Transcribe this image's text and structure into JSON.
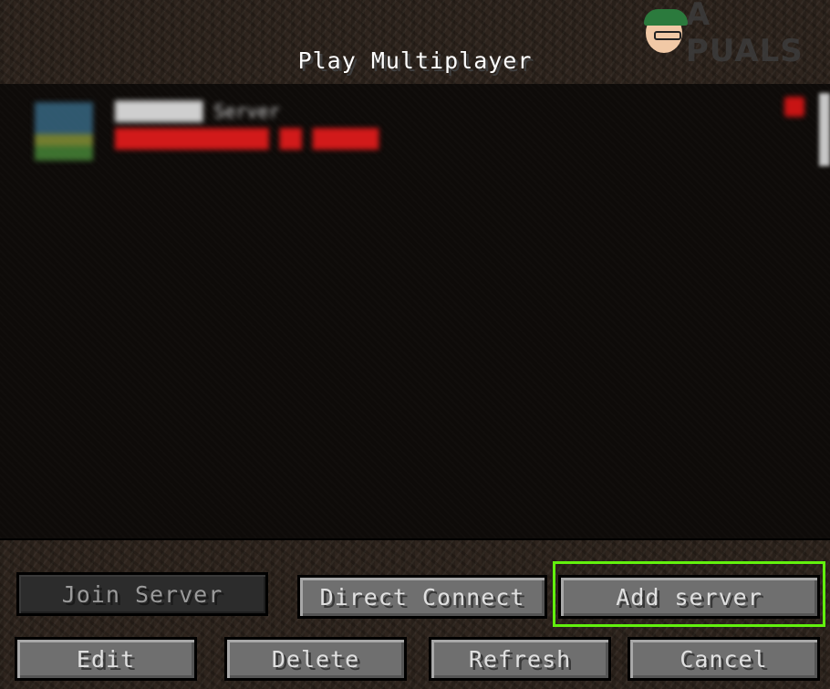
{
  "screen": {
    "title": "Play Multiplayer"
  },
  "watermark": {
    "text": "A  PUALS"
  },
  "server_list": {
    "entries": [
      {
        "name": "████████ Server",
        "status": "██████████████ ██ ██████"
      }
    ]
  },
  "buttons": {
    "join_server": "Join Server",
    "direct_connect": "Direct Connect",
    "add_server": "Add server",
    "edit": "Edit",
    "delete": "Delete",
    "refresh": "Refresh",
    "cancel": "Cancel"
  },
  "colors": {
    "highlight": "#62f00e",
    "status_error": "#d21a1a"
  }
}
